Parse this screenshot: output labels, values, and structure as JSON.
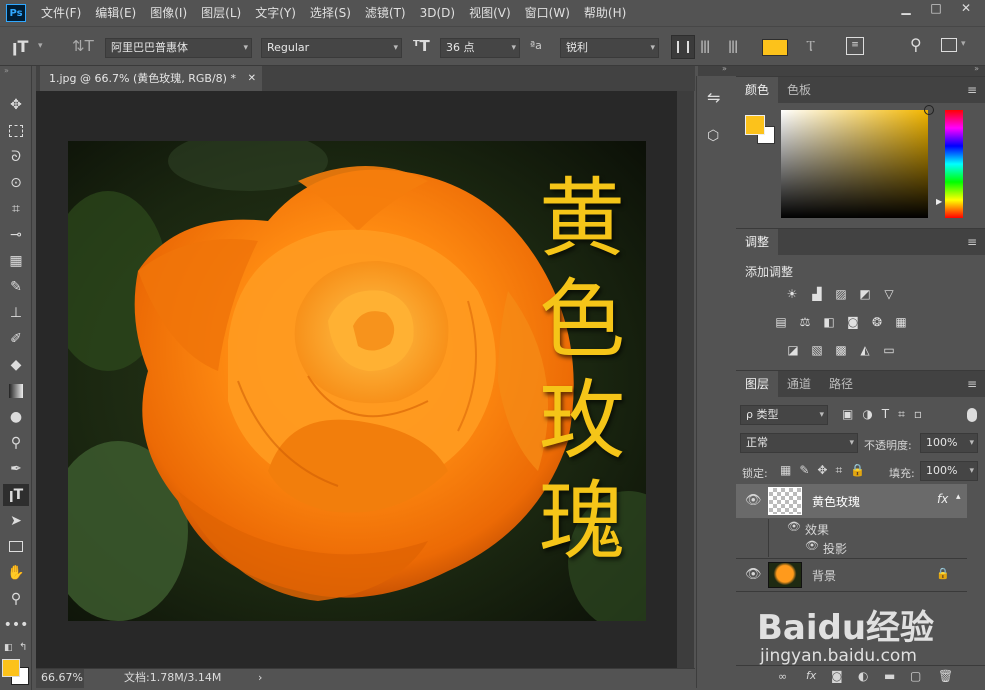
{
  "app": {
    "logo": "Ps"
  },
  "menu": {
    "items": [
      "文件(F)",
      "编辑(E)",
      "图像(I)",
      "图层(L)",
      "文字(Y)",
      "选择(S)",
      "滤镜(T)",
      "3D(D)",
      "视图(V)",
      "窗口(W)",
      "帮助(H)"
    ]
  },
  "window_controls": {
    "minimize": "▁",
    "restore": "□",
    "close": "✕"
  },
  "options": {
    "font_family": "阿里巴巴普惠体",
    "font_style": "Regular",
    "font_size": "36 点",
    "antialias_icon_label": "ªa",
    "antialias": "锐利",
    "text_color": "#fcc21b"
  },
  "document": {
    "tab_title": "1.jpg @ 66.7% (黄色玫瑰, RGB/8) *",
    "tab_close": "✕",
    "text_layer_content": "黄色玫瑰",
    "text_color": "#f5c518"
  },
  "status": {
    "zoom": "66.67%",
    "doc_info": "文档:1.78M/3.14M",
    "arrow": "›"
  },
  "color_panel": {
    "tabs": [
      "颜色",
      "色板"
    ],
    "foreground": "#fcc21b",
    "background": "#ffffff"
  },
  "adjust_panel": {
    "tab": "调整",
    "title": "添加调整"
  },
  "layers_panel": {
    "tabs": [
      "图层",
      "通道",
      "路径"
    ],
    "filter_kind": "ρ 类型",
    "blend_mode": "正常",
    "opacity_label": "不透明度:",
    "opacity_value": "100%",
    "lock_label": "锁定:",
    "fill_label": "填充:",
    "fill_value": "100%",
    "layers": [
      {
        "name": "黄色玫瑰",
        "fx": "fx",
        "effects_label": "效果",
        "effect": "投影"
      },
      {
        "name": "背景"
      }
    ]
  },
  "watermark": {
    "brand": "Baidu经验",
    "url": "jingyan.baidu.com"
  }
}
